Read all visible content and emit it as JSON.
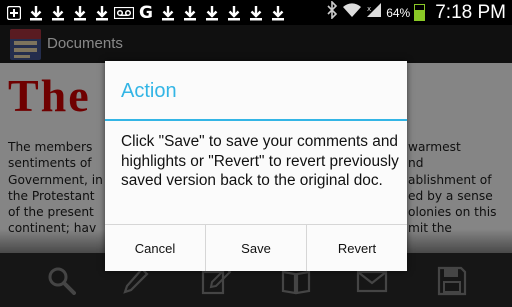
{
  "status_bar": {
    "notification_icons": [
      "add-icon",
      "download-icon",
      "download-icon",
      "download-icon",
      "download-icon",
      "voicemail-icon",
      "google-icon",
      "download-icon",
      "download-icon",
      "download-icon",
      "download-icon",
      "download-icon",
      "download-icon"
    ],
    "battery_percent": "64%",
    "time": "7:18 PM"
  },
  "app_bar": {
    "title": "Documents"
  },
  "document": {
    "heading_left": "The S",
    "heading_right": "",
    "text_left": [
      "The members",
      "sentiments of",
      "Government, in",
      "the Protestant",
      "of the present",
      "continent; hav",
      ""
    ],
    "text_right": [
      "warmest",
      "nd",
      "ablishment of",
      "ed by a sense",
      "olonies on this",
      "mit the",
      ""
    ]
  },
  "toolbar": {
    "buttons": [
      "search-icon",
      "pencil-icon",
      "edit-icon",
      "book-icon",
      "mail-icon",
      "save-icon"
    ]
  },
  "dialog": {
    "title": "Action",
    "message": "Click \"Save\" to save your comments and highlights or \"Revert\" to revert previously saved version back to the original doc.",
    "buttons": {
      "cancel": "Cancel",
      "save": "Save",
      "revert": "Revert"
    }
  }
}
